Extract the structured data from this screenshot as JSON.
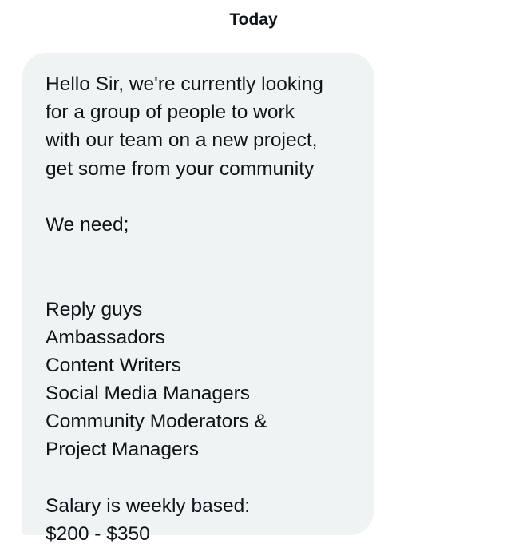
{
  "conversation": {
    "date_divider": "Today"
  },
  "message": {
    "paragraphs": [
      [
        "Hello Sir, we're currently looking",
        "for a group of people to work",
        "with our team on a new project,",
        "get some from your community"
      ],
      [
        "We need;"
      ],
      [
        "Reply guys",
        "Ambassadors",
        "Content Writers",
        "Social Media Managers",
        "Community Moderators &",
        "Project Managers"
      ],
      [
        "Salary is weekly based:",
        "$200 - $350"
      ]
    ]
  }
}
